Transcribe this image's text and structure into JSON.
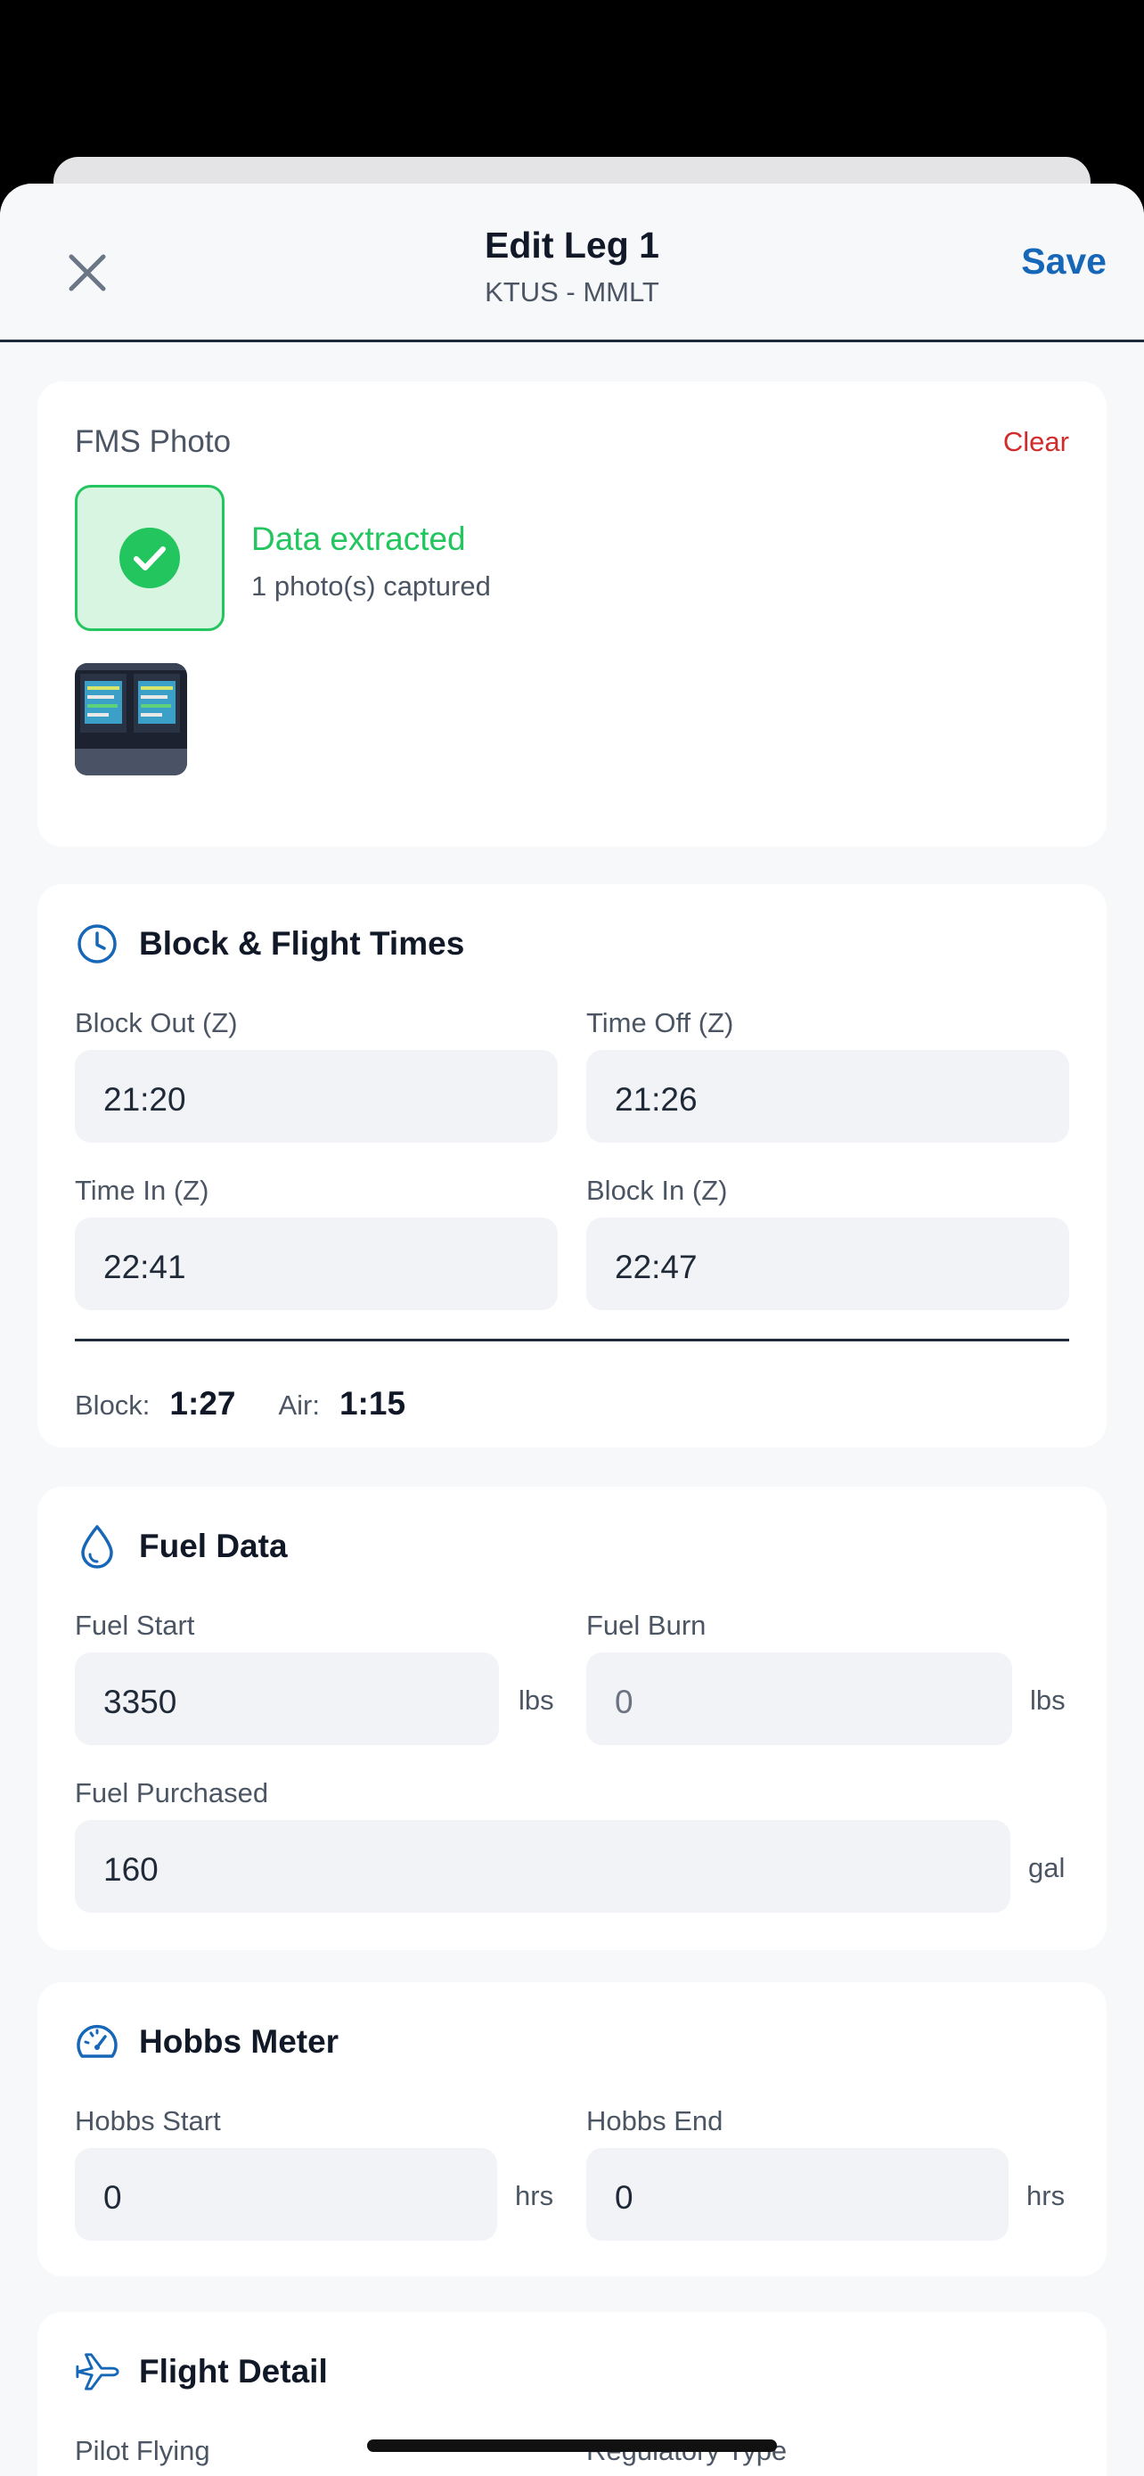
{
  "header": {
    "title": "Edit Leg 1",
    "route": "KTUS - MMLT",
    "save_label": "Save"
  },
  "fms": {
    "label": "FMS Photo",
    "clear_label": "Clear",
    "status": "Data extracted",
    "photos": "1 photo(s) captured"
  },
  "times": {
    "title": "Block & Flight Times",
    "block_out_label": "Block Out (Z)",
    "block_out": "21:20",
    "time_off_label": "Time Off (Z)",
    "time_off": "21:26",
    "time_in_label": "Time In (Z)",
    "time_in": "22:41",
    "block_in_label": "Block In (Z)",
    "block_in": "22:47",
    "block_key": "Block:",
    "block_val": "1:27",
    "air_key": "Air:",
    "air_val": "1:15"
  },
  "fuel": {
    "title": "Fuel Data",
    "start_label": "Fuel Start",
    "start": "3350",
    "start_unit": "lbs",
    "burn_label": "Fuel Burn",
    "burn": "0",
    "burn_unit": "lbs",
    "purchased_label": "Fuel Purchased",
    "purchased": "160",
    "purchased_unit": "gal"
  },
  "hobbs": {
    "title": "Hobbs Meter",
    "start_label": "Hobbs Start",
    "start": "0",
    "start_unit": "hrs",
    "end_label": "Hobbs End",
    "end": "0",
    "end_unit": "hrs"
  },
  "detail": {
    "title": "Flight Detail",
    "pilot_label": "Pilot Flying",
    "reg_label": "Regulatory Type"
  },
  "colors": {
    "accent": "#1767b8",
    "success": "#22c55e",
    "danger": "#d12b2b"
  }
}
